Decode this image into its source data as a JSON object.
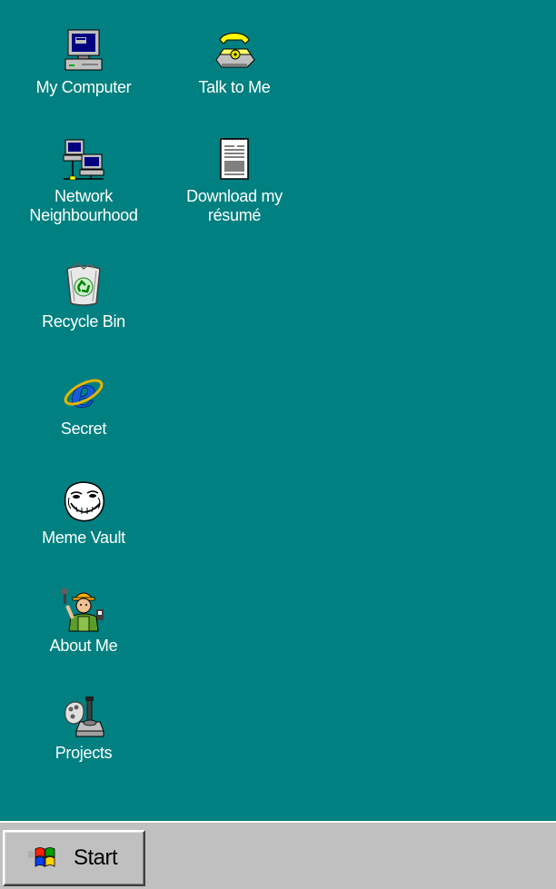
{
  "desktop": {
    "background_color": "#008080",
    "icons": [
      {
        "id": "my-computer",
        "label": "My Computer",
        "icon": "computer-icon"
      },
      {
        "id": "talk",
        "label": "Talk to Me",
        "icon": "telephone-icon"
      },
      {
        "id": "network",
        "label": "Network\nNeighbourhood",
        "icon": "network-icon"
      },
      {
        "id": "resume",
        "label": "Download my\nrésumé",
        "icon": "document-icon"
      },
      {
        "id": "recycle",
        "label": "Recycle Bin",
        "icon": "recycle-bin-icon"
      },
      {
        "id": "secret",
        "label": "Secret",
        "icon": "internet-explorer-icon"
      },
      {
        "id": "meme",
        "label": "Meme Vault",
        "icon": "trollface-icon"
      },
      {
        "id": "about",
        "label": "About Me",
        "icon": "worker-icon"
      },
      {
        "id": "projects",
        "label": "Projects",
        "icon": "joystick-icon"
      }
    ]
  },
  "taskbar": {
    "background_color": "#c0c0c0",
    "start": {
      "label": "Start",
      "icon": "windows-logo-icon"
    }
  }
}
